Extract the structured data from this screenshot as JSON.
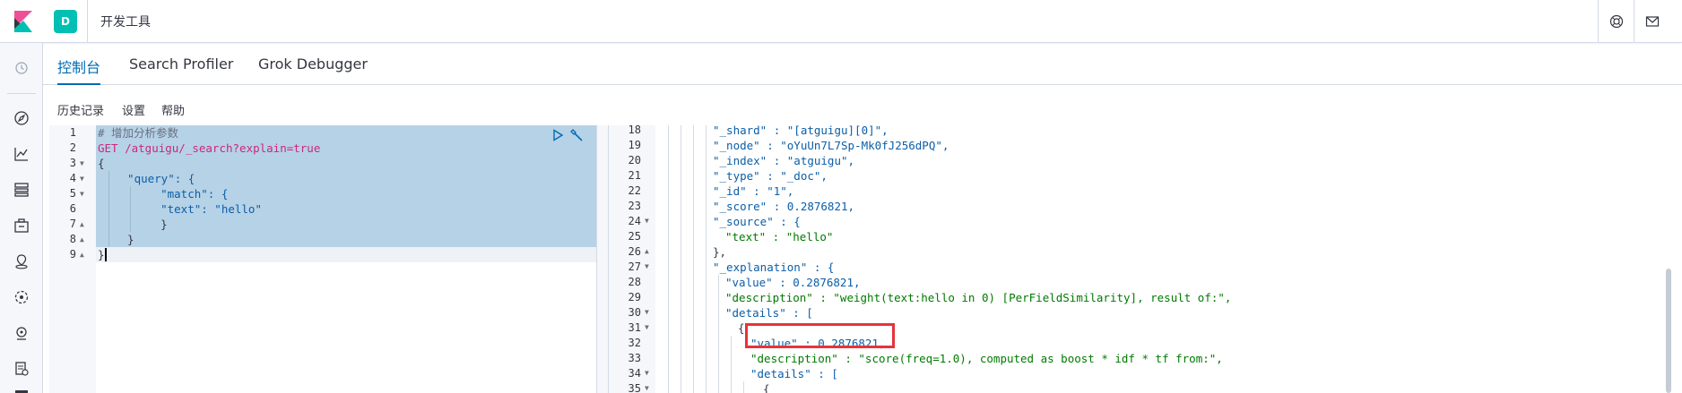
{
  "header": {
    "space_initial": "D",
    "title": "开发工具"
  },
  "tabs": [
    {
      "label": "控制台",
      "active": true
    },
    {
      "label": "Search Profiler",
      "active": false
    },
    {
      "label": "Grok Debugger",
      "active": false
    }
  ],
  "toolbar": {
    "history": "历史记录",
    "settings": "设置",
    "help": "帮助"
  },
  "request_editor": {
    "line_numbers": [
      "1",
      "2",
      "3",
      "4",
      "5",
      "6",
      "7",
      "8",
      "9"
    ],
    "lines": [
      "# 增加分析参数",
      "GET /atguigu/_search?explain=true",
      "{",
      "  \"query\": {",
      "    \"match\": {",
      "    \"text\": \"hello\"",
      "    }",
      "  }",
      "}"
    ]
  },
  "response_editor": {
    "line_numbers": [
      "18",
      "19",
      "20",
      "21",
      "22",
      "23",
      "24",
      "25",
      "26",
      "27",
      "28",
      "29",
      "30",
      "31",
      "32",
      "33",
      "34",
      "35"
    ],
    "lines": [
      "\"_shard\" : \"[atguigu][0]\",",
      "\"_node\" : \"oYuUn7L7Sp-Mk0fJ256dPQ\",",
      "\"_index\" : \"atguigu\",",
      "\"_type\" : \"_doc\",",
      "\"_id\" : \"1\",",
      "\"_score\" : 0.2876821,",
      "\"_source\" : {",
      "\"text\" : \"hello\"",
      "},",
      "\"_explanation\" : {",
      "\"value\" : 0.2876821,",
      "\"description\" : \"weight(text:hello in 0) [PerFieldSimilarity], result of:\",",
      "\"details\" : [",
      "{",
      "\"value\" : 0.2876821,",
      "\"description\" : \"score(freq=1.0), computed as boost * idf * tf from:\",",
      "\"details\" : [",
      "{"
    ]
  },
  "colors": {
    "accent": "#006bb4",
    "selection": "#b6d2e6",
    "highlight_box": "#e7333a",
    "space_badge": "#00bfb3"
  }
}
